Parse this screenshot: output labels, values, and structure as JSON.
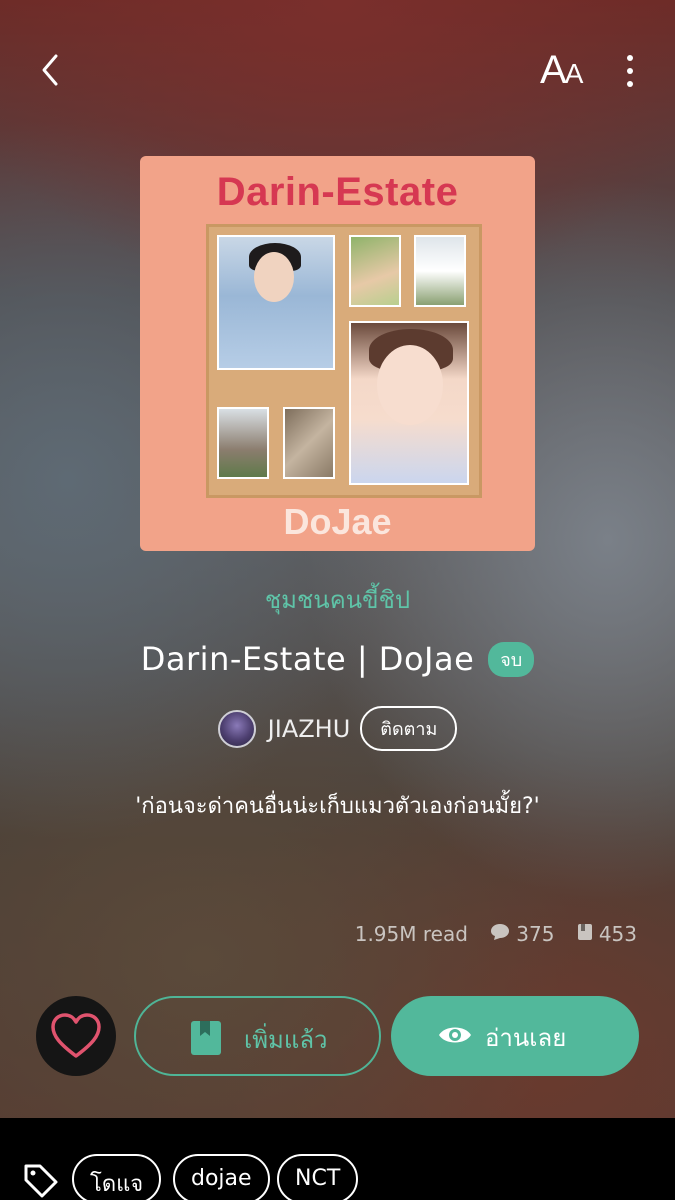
{
  "topbar": {
    "font_size_label_big": "A",
    "font_size_label_small": "A"
  },
  "cover": {
    "title": "Darin-Estate",
    "subtitle": "DoJae"
  },
  "story": {
    "category": "ชุมชนคนขี้ชิป",
    "title": "Darin-Estate | DoJae",
    "status_badge": "จบ",
    "author": "JIAZHU",
    "follow_label": "ติดตาม",
    "tagline": "'ก่อนจะด่าคนอื่นน่ะเก็บแมวตัวเองก่อนมั้ย?'"
  },
  "stats": {
    "reads": "1.95M read",
    "comments": "375",
    "library": "453"
  },
  "actions": {
    "added_label": "เพิ่มแล้ว",
    "read_label": "อ่านเลย"
  },
  "tags": [
    "โดแจ",
    "dojae",
    "NCT"
  ],
  "colors": {
    "accent": "#52b89b",
    "heart": "#e0536e",
    "cover_bg": "#f2a389",
    "cover_title": "#d63852"
  },
  "icons": [
    "back-arrow-icon",
    "font-size-icon",
    "more-vertical-icon",
    "heart-icon",
    "bookmark-icon",
    "eye-icon",
    "comment-icon",
    "library-icon",
    "tag-icon"
  ]
}
